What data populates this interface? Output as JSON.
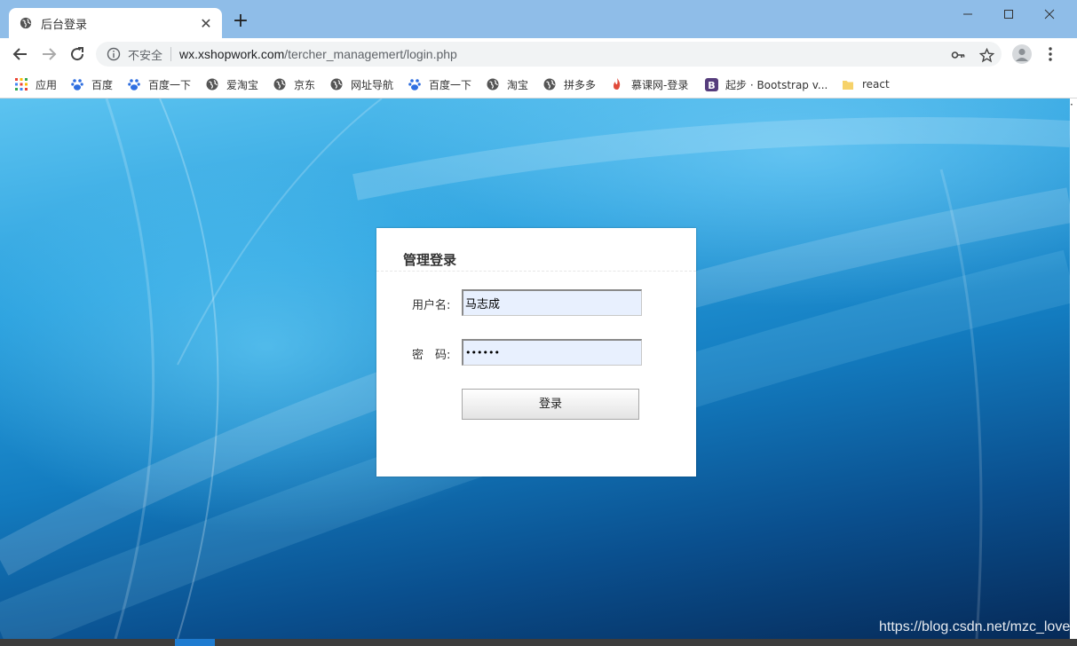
{
  "tab": {
    "title": "后台登录"
  },
  "omnibox": {
    "security_label": "不安全",
    "url_host": "wx.xshopwork.com",
    "url_path": "/tercher_managemert/login.php"
  },
  "bookmarks": [
    {
      "label": "应用",
      "icon": "apps-grid-icon"
    },
    {
      "label": "百度",
      "icon": "baidu-paw-icon"
    },
    {
      "label": "百度一下",
      "icon": "baidu-paw-icon"
    },
    {
      "label": "爱淘宝",
      "icon": "globe-icon"
    },
    {
      "label": "京东",
      "icon": "globe-icon"
    },
    {
      "label": "网址导航",
      "icon": "globe-icon"
    },
    {
      "label": "百度一下",
      "icon": "baidu-paw-icon"
    },
    {
      "label": "淘宝",
      "icon": "globe-icon"
    },
    {
      "label": "拼多多",
      "icon": "globe-icon"
    },
    {
      "label": "慕课网-登录",
      "icon": "flame-icon"
    },
    {
      "label": "起步 · Bootstrap v...",
      "icon": "bootstrap-icon"
    },
    {
      "label": "react",
      "icon": "folder-icon"
    }
  ],
  "login": {
    "title": "管理登录",
    "username_label": "用户名:",
    "username_value": "马志成",
    "password_label": "密　码:",
    "password_value": "••••••",
    "submit_label": "登录"
  },
  "watermark": "https://blog.csdn.net/mzc_love",
  "colors": {
    "titlebar": "#8fbde8",
    "input_autofill": "#e8f0fe"
  }
}
